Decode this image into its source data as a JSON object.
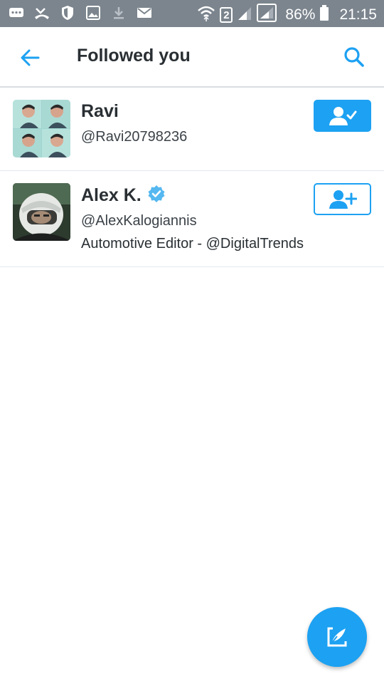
{
  "status_bar": {
    "sim_slot": "2",
    "battery": "86%",
    "time": "21:15"
  },
  "header": {
    "title": "Followed you"
  },
  "users": [
    {
      "name": "Ravi",
      "handle": "@Ravi20798236",
      "follow_state": "following"
    },
    {
      "name": "Alex K.",
      "handle": "@AlexKalogiannis",
      "bio": "Automotive Editor - @DigitalTrends",
      "verified": true,
      "follow_state": "follow"
    }
  ],
  "colors": {
    "accent": "#1da1f2",
    "status_bar": "#7c858e",
    "text_primary": "#292f33"
  }
}
